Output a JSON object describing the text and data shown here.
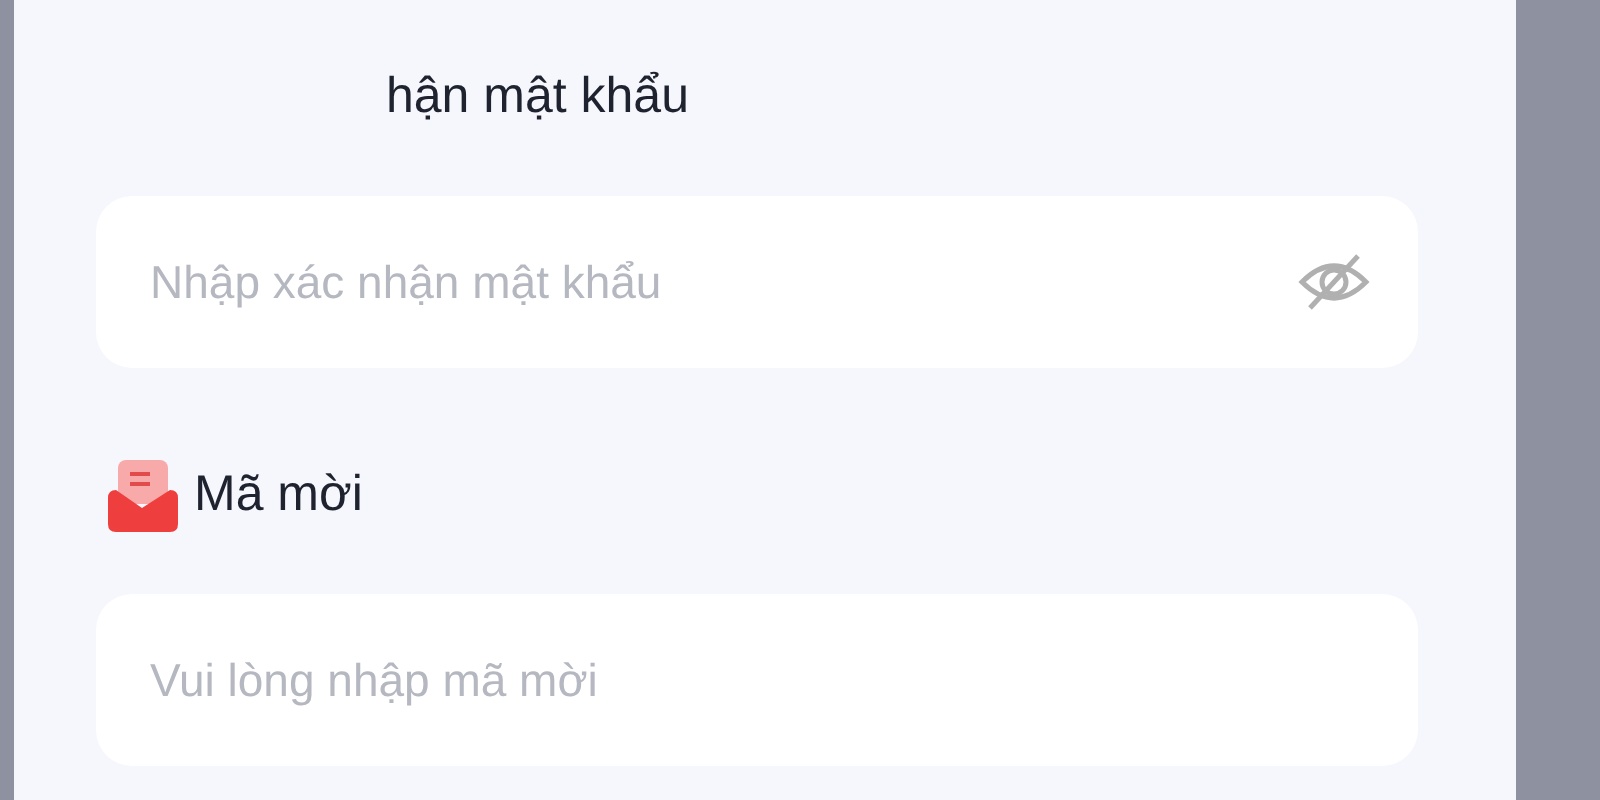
{
  "fields": [
    {
      "label": "hận mật khẩu",
      "placeholder": "Nhập xác nhận mật khẩu",
      "kind": "password",
      "password_visible": false
    },
    {
      "label": "Mã mời",
      "placeholder": "Vui lòng nhập mã mời",
      "kind": "invite"
    }
  ]
}
